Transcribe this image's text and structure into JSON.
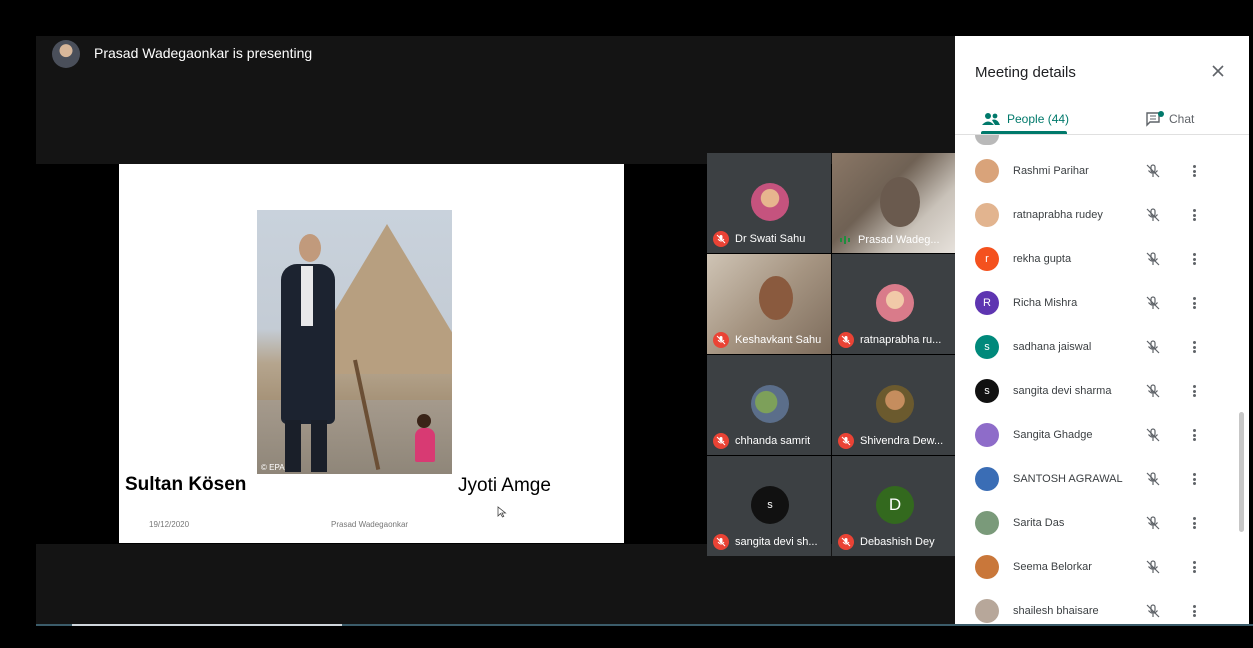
{
  "presenter": {
    "text": "Prasad Wadegaonkar is presenting"
  },
  "slide": {
    "left_label": "Sultan Kösen",
    "right_label": "Jyoti Amge",
    "photo_credit": "© EPA",
    "date": "19/12/2020",
    "author": "Prasad Wadegaonkar"
  },
  "tiles": [
    {
      "name": "Dr Swati Sahu",
      "muted": true
    },
    {
      "name": "Prasad Wadeg...",
      "muted": false
    },
    {
      "name": "Keshavkant Sahu",
      "muted": true
    },
    {
      "name": "ratnaprabha ru...",
      "muted": true
    },
    {
      "name": "chhanda samrit",
      "muted": true
    },
    {
      "name": "Shivendra Dew...",
      "muted": true
    },
    {
      "name": "sangita devi sh...",
      "muted": true,
      "initial": "s"
    },
    {
      "name": "Debashish Dey",
      "muted": true,
      "initial": "D"
    }
  ],
  "panel": {
    "title": "Meeting details",
    "tab_people": "People (44)",
    "tab_chat": "Chat",
    "accent_color": "#00796b"
  },
  "people": [
    {
      "name": "Rashmi Parihar",
      "initial": "",
      "color": "#d9a37a"
    },
    {
      "name": "ratnaprabha rudey",
      "initial": "",
      "color": "#e2b48f"
    },
    {
      "name": "rekha gupta",
      "initial": "r",
      "color": "#f4511e"
    },
    {
      "name": "Richa Mishra",
      "initial": "R",
      "color": "#5e35b1"
    },
    {
      "name": "sadhana jaiswal",
      "initial": "s",
      "color": "#00897b"
    },
    {
      "name": "sangita devi sharma",
      "initial": "s",
      "color": "#111111"
    },
    {
      "name": "Sangita Ghadge",
      "initial": "",
      "color": "#8e6cc9"
    },
    {
      "name": "SANTOSH AGRAWAL",
      "initial": "",
      "color": "#3a6db5"
    },
    {
      "name": "Sarita Das",
      "initial": "",
      "color": "#7a9a7a"
    },
    {
      "name": "Seema Belorkar",
      "initial": "",
      "color": "#c9773a"
    },
    {
      "name": "shailesh bhaisare",
      "initial": "",
      "color": "#b7a79a"
    }
  ]
}
